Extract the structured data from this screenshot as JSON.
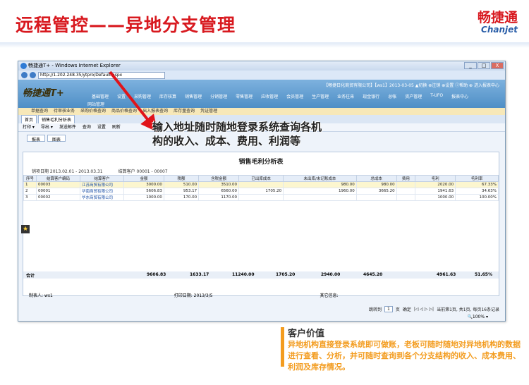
{
  "slide": {
    "title": "远程管控——异地分支管理",
    "logo_cn": "畅捷通",
    "logo_en": "Chanjet"
  },
  "browser": {
    "window_title": "畅捷通T+ - Windows Internet Explorer",
    "address": "http://1.202.248.35/ytpro/Default.aspx",
    "buttons": [
      "_",
      "□",
      "X"
    ]
  },
  "app": {
    "logo": "畅捷通T+",
    "user_info": "【畅捷日化商贸有限公司】【ws1】2013-03-05 ▲切换 ⊗注销 ⊕设置 ⓘ帮助 ⊕ 进入报表中心",
    "menu": [
      "基础管理",
      "设置",
      "采购管理",
      "库存核算",
      "销售管理",
      "分销管理",
      "零售管理",
      "应收管理",
      "会员管理",
      "生产管理",
      "业务往来",
      "现金银行",
      "总帐",
      "资产管理",
      "T-UFO",
      "报表中心"
    ],
    "submenu": "网站管理",
    "opbar": [
      "单据查询",
      "待审核业务",
      "采购价格查询",
      "商品价格查询",
      "出入报表查询",
      "库存量查询",
      "凭证管理"
    ],
    "tabs": [
      "首页",
      "销售毛利分析表"
    ],
    "toolbar": [
      "打印 ▾",
      "导出 ▾",
      "发送邮件",
      "查询",
      "设置",
      "刷新"
    ],
    "subtabs": [
      "报表",
      "图表"
    ]
  },
  "report": {
    "title": "销售毛利分析表",
    "period_label": "销项日期 2013.02.01 - 2013.03.31",
    "customer_label": "结算客户 00001 - 00007",
    "columns": [
      "序号",
      "结算客户编码",
      "结算客户",
      "金额",
      "税额",
      "含税金额",
      "已出库成本",
      "未出库/未记账成本",
      "总成本",
      "费用",
      "毛利",
      "毛利率"
    ],
    "rows": [
      [
        "1",
        "00003",
        "江苏商贸有限公司",
        "3000.00",
        "510.00",
        "3510.00",
        "",
        "980.00",
        "980.00",
        "",
        "2020.00",
        "67.33%"
      ],
      [
        "2",
        "00001",
        "华南商贸有限公司",
        "5606.83",
        "953.17",
        "6560.00",
        "1705.20",
        "1960.00",
        "3665.20",
        "",
        "1941.63",
        "34.63%"
      ],
      [
        "3",
        "00002",
        "华东商贸有限公司",
        "1000.00",
        "170.00",
        "1170.00",
        "",
        "",
        "",
        "",
        "1000.00",
        "100.00%"
      ]
    ],
    "total_label": "合计",
    "totals": [
      "9606.83",
      "1633.17",
      "11240.00",
      "1705.20",
      "2940.00",
      "4645.20",
      "4961.63",
      "51.65%"
    ],
    "maker": "制表人: ws1",
    "print_date": "打印日期: 2013/3/5",
    "other_info": "其它信息:",
    "pager": [
      "跳转到",
      "1",
      "页",
      "确定",
      "|◁ ◁ ▷ ▷|",
      "当前第1页, 共1页, 每页16条记录"
    ],
    "zoom": "🔍100% ▾"
  },
  "overlay": {
    "line1": "输入地址随时随地登录系统查询各机",
    "line2": "构的收入、成本、费用、利润等"
  },
  "value": {
    "heading": "客户价值",
    "text": "异地机构直接登录系统即可做账，老板可随时随地对异地机构的数据进行查看、分析，并可随时查询到各个分支结构的收入、成本费用、利润及库存情况。"
  },
  "colors": {
    "title_red": "#d8191f",
    "accent_orange": "#f39c1f",
    "app_blue": "#4f8fc6"
  }
}
